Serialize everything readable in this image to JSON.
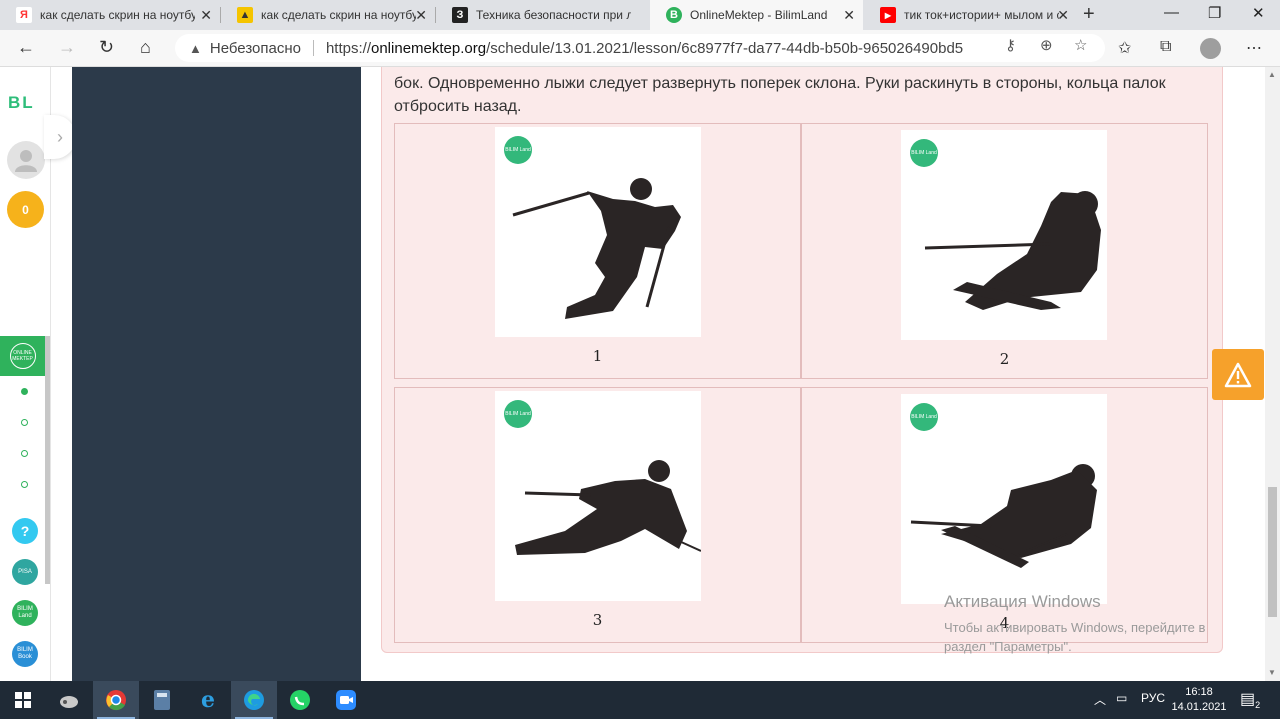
{
  "browser": {
    "tabs": [
      {
        "title": "как сделать скрин на ноутбуке",
        "favicon": "Я",
        "favicon_color": "#ffffff",
        "favicon_text_color": "#f33"
      },
      {
        "title": "как сделать скрин на ноутбуке",
        "favicon": "▲",
        "favicon_color": "#f5c400",
        "favicon_text_color": "#333"
      },
      {
        "title": "Техника безопасности при лы...",
        "favicon": "З",
        "favicon_color": "#222222",
        "favicon_text_color": "#fff"
      },
      {
        "title": "OnlineMektep - BilimLand",
        "favicon": "B",
        "favicon_color": "#2fb25c",
        "favicon_text_color": "#fff"
      },
      {
        "title": "тик ток+истории+ мылом и с...",
        "favicon": "▶",
        "favicon_color": "#ff0000",
        "favicon_text_color": "#fff"
      }
    ],
    "new_tab": "+",
    "address": {
      "security_label": "Небезопасно",
      "url_prefix": "https://",
      "url_host": "onlinemektep.org",
      "url_path": "/schedule/13.01.2021/lesson/6c8977f7-da77-44db-b50b-965026490bd5"
    }
  },
  "sidebar": {
    "logo": "BL",
    "coins": "0",
    "active_item": "ONLINE MEKTEP",
    "apps": [
      {
        "label": "?",
        "color": "#33c9f0"
      },
      {
        "label": "PISA",
        "color": "#2fa6a0"
      },
      {
        "label": "BILIM Land",
        "color": "#2fb25c"
      },
      {
        "label": "BILIM Book",
        "color": "#2a8fd6"
      }
    ]
  },
  "lesson": {
    "text": "бок. Одновременно лыжи следует развернуть поперек склона. Руки раскинуть в стороны, кольца палок отбросить назад.",
    "badge": "BILIM Land",
    "options": [
      {
        "label": "1"
      },
      {
        "label": "2"
      },
      {
        "label": "3"
      },
      {
        "label": "4"
      }
    ]
  },
  "windows_activation": {
    "title": "Активация Windows",
    "line1": "Чтобы активировать Windows, перейдите в",
    "line2": "раздел \"Параметры\"."
  },
  "taskbar": {
    "language": "РУС",
    "time": "16:18",
    "date": "14.01.2021",
    "notifications": "2"
  }
}
